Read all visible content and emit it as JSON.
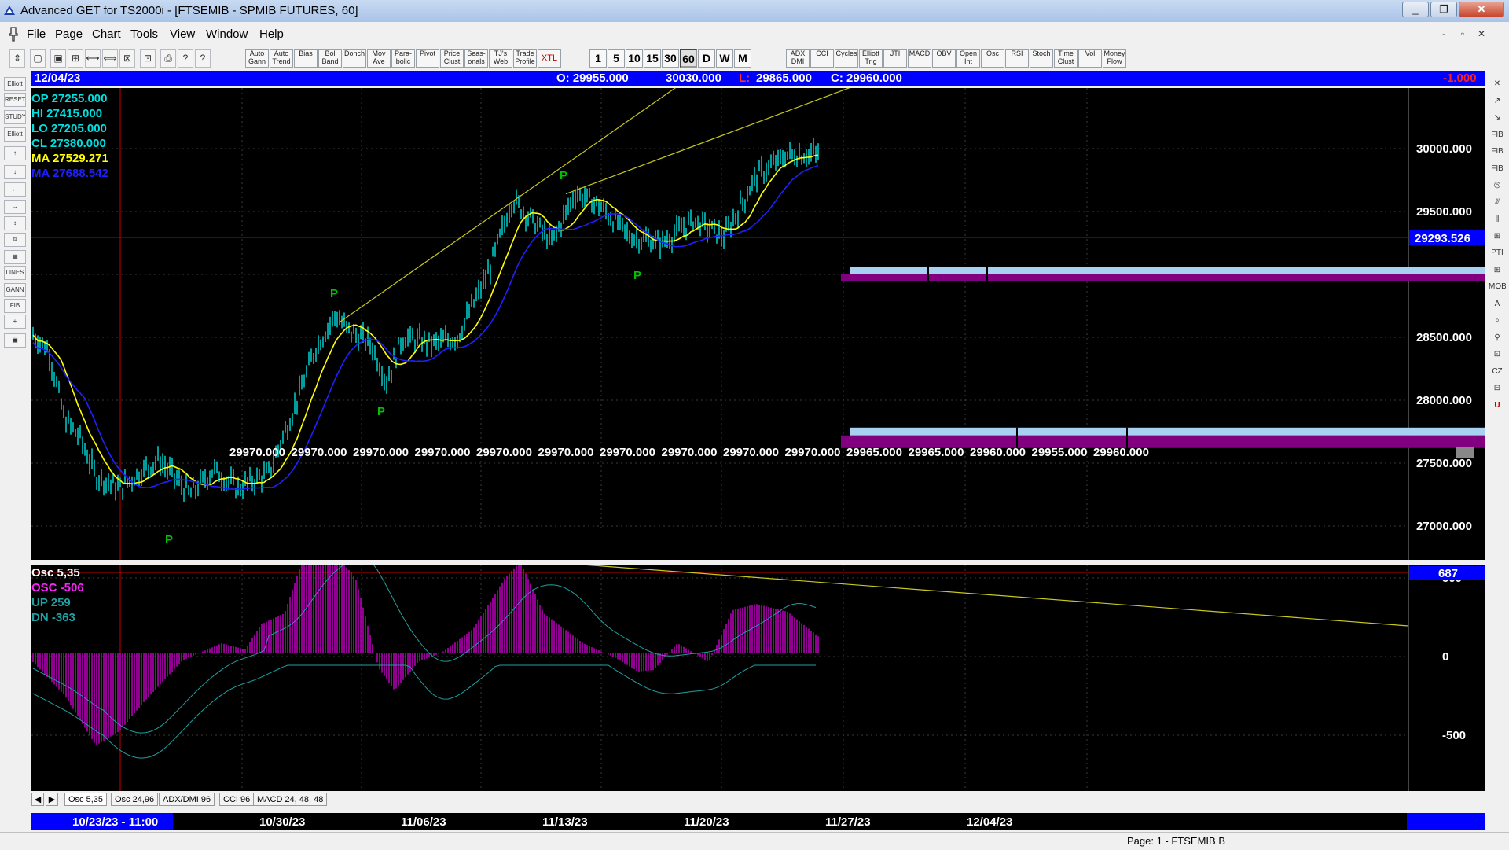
{
  "window": {
    "title": "Advanced GET for TS2000i - [FTSEMIB - SPMIB FUTURES, 60]",
    "controls": [
      "_",
      "❐",
      "✕"
    ],
    "mdi_controls": [
      "-",
      "▫",
      "✕"
    ]
  },
  "menu": [
    "File",
    "Page",
    "Chart",
    "Tools",
    "View",
    "Window",
    "Help"
  ],
  "toolbar": {
    "study_buttons": [
      "Auto Gann",
      "Auto Trend",
      "Bias",
      "Bol Band",
      "Donch",
      "Mov Ave",
      "Para-bolic",
      "Pivot",
      "Price Clust",
      "Seas-onals",
      "TJ's Web",
      "Trade Profile",
      "XTL"
    ],
    "timeframes": [
      "1",
      "5",
      "10",
      "15",
      "30",
      "60",
      "D",
      "W",
      "M"
    ],
    "indicator_buttons": [
      "ADX DMI",
      "CCI",
      "Cycles",
      "Elliott Trig",
      "JTI",
      "MACD",
      "OBV",
      "Open Int",
      "Osc",
      "RSI",
      "Stoch",
      "Time Clust",
      "Vol",
      "Money Flow"
    ]
  },
  "left_tools": [
    "Elliott",
    "RESET",
    "STUDY",
    "Elliott",
    "↑",
    "↓",
    "←",
    "→",
    "↕",
    "⇅",
    "▦",
    "LINES",
    "GANN",
    "FIB",
    "+",
    "▣"
  ],
  "right_tools": [
    "✕",
    "↗",
    "↘",
    "FIB RET",
    "FIB EXT",
    "FIB TIME",
    "◎",
    "⫻",
    "⫼",
    "⊞",
    "PTI",
    "⊞",
    "MOB",
    "A",
    "⌕",
    "⚲",
    "⊡",
    "CZ",
    "⊟",
    "U"
  ],
  "header": {
    "date": "12/04/23",
    "open": "O: 29955.000",
    "high": "30030.000",
    "low_label": "L:",
    "low": "29865.000",
    "close": "C: 29960.000",
    "change": "-1.000"
  },
  "info": {
    "op": "OP  27255.000",
    "hi": "HI   27415.000",
    "lo": "LO  27205.000",
    "cl": "CL  27380.000",
    "ma1": "MA  27529.271",
    "ma2": "MA  27688.542"
  },
  "price_axis": [
    "30000.000",
    "29500.000",
    "29000.000",
    "28500.000",
    "28000.000",
    "27500.000",
    "27000.000"
  ],
  "cursor_price": "29293.526",
  "bottom_values": [
    "29970.000",
    "29970.000",
    "29970.000",
    "29970.000",
    "29970.000",
    "29970.000",
    "29970.000",
    "29970.000",
    "29970.000",
    "29970.000",
    "29965.000",
    "29965.000",
    "29960.000",
    "29955.000",
    "29960.000"
  ],
  "osc": {
    "title": "Osc 5,35",
    "osc": "OSC -506",
    "up": "UP   259",
    "dn": "DN   -363",
    "current": "687",
    "axis": [
      "500",
      "0",
      "-500"
    ]
  },
  "pivot_label": "P",
  "tabs": [
    "Osc 5,35",
    "Osc 24,96",
    "ADX/DMI 96",
    "CCI 96",
    "MACD 24, 48, 48"
  ],
  "dates": [
    "10/23/23 - 11:00",
    "10/30/23",
    "11/06/23",
    "11/13/23",
    "11/20/23",
    "11/27/23",
    "12/04/23"
  ],
  "status": "Page: 1 - FTSEMIB B",
  "colors": {
    "up_bar": "#00e0e0",
    "ma_fast": "#ffff00",
    "ma_slow": "#2020ff",
    "trend": "#c8c820",
    "osc_bar": "#c000c0",
    "pivot": "#00c000",
    "header_bg": "#0000ff",
    "zone_light": "#a8d0f0",
    "zone_dark": "#800080"
  }
}
